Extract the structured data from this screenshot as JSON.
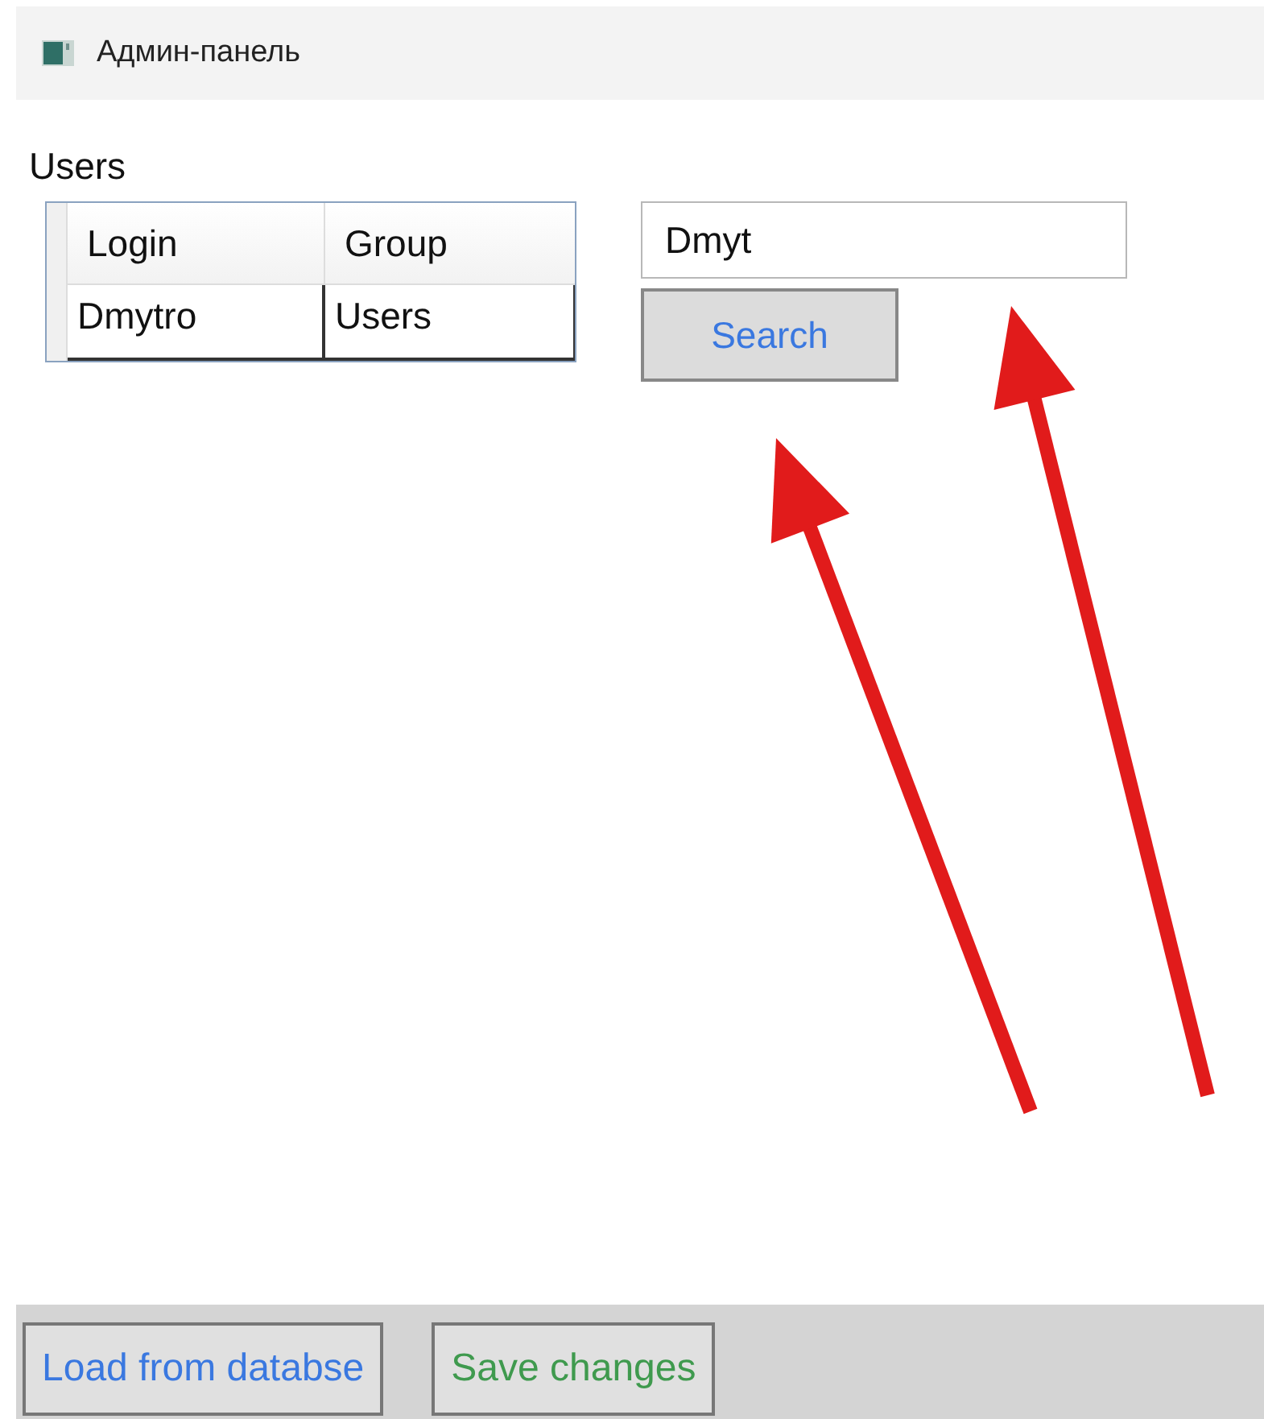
{
  "window": {
    "title": "Админ-панель"
  },
  "users_label": "Users",
  "table": {
    "columns": [
      "Login",
      "Group"
    ],
    "rows": [
      [
        "Dmytro",
        "Users"
      ]
    ]
  },
  "search": {
    "value": "Dmyt",
    "button": "Search"
  },
  "footer_buttons": [
    {
      "label": "Load from databse",
      "color": "#3a78e0"
    },
    {
      "label": "Save changes",
      "color": "#3f9a4e"
    }
  ],
  "annotations": [
    {
      "kind": "arrow"
    },
    {
      "kind": "arrow"
    }
  ]
}
